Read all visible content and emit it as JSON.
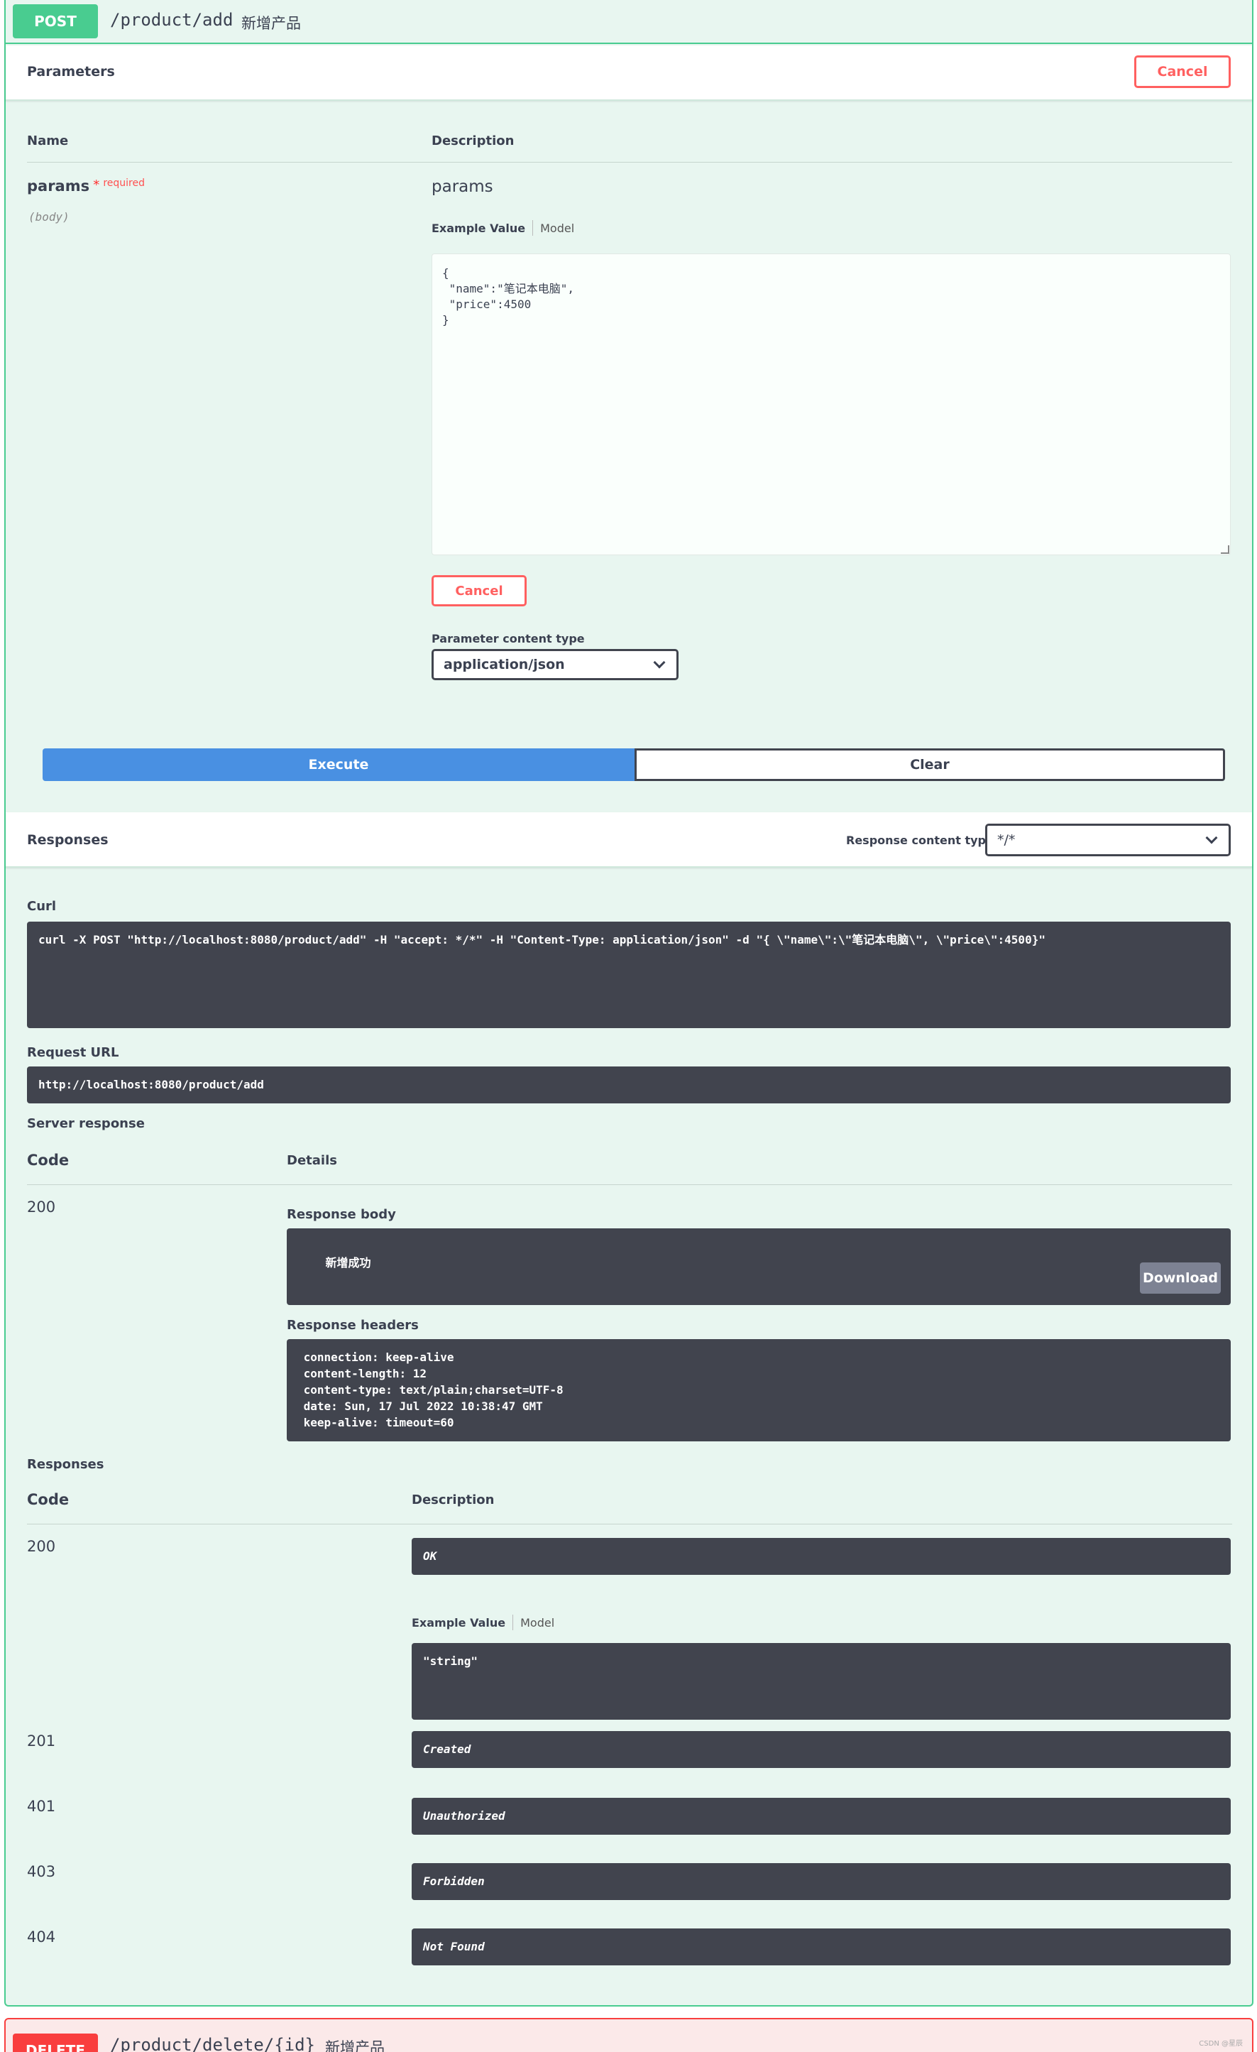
{
  "operation": {
    "method": "POST",
    "path": "/product/add",
    "summary": "新增产品"
  },
  "parameters": {
    "title": "Parameters",
    "cancel_label": "Cancel",
    "col_name": "Name",
    "col_description": "Description",
    "param_name": "params",
    "required_mark": "*",
    "required_label": "required",
    "param_in": "(body)",
    "param_description": "params",
    "example_value_label": "Example Value",
    "model_label": "Model",
    "body_value": "{\n \"name\":\"笔记本电脑\",\n \"price\":4500\n}",
    "cancel_small_label": "Cancel",
    "content_type_label": "Parameter content type",
    "content_type_value": "application/json"
  },
  "actions": {
    "execute_label": "Execute",
    "clear_label": "Clear"
  },
  "responses_header": {
    "title": "Responses",
    "content_type_label": "Response content type",
    "content_type_value": "*/*"
  },
  "live": {
    "curl_label": "Curl",
    "curl_value": "curl -X POST \"http://localhost:8080/product/add\" -H \"accept: */*\" -H \"Content-Type: application/json\" -d \"{ \\\"name\\\":\\\"笔记本电脑\\\", \\\"price\\\":4500}\"",
    "request_url_label": "Request URL",
    "request_url_value": "http://localhost:8080/product/add",
    "server_response_label": "Server response",
    "col_code": "Code",
    "col_details": "Details",
    "status_code": "200",
    "response_body_label": "Response body",
    "response_body_value": "新增成功",
    "download_label": "Download",
    "response_headers_label": "Response headers",
    "response_headers_value": " connection: keep-alive\n content-length: 12\n content-type: text/plain;charset=UTF-8\n date: Sun, 17 Jul 2022 10:38:47 GMT\n keep-alive: timeout=60"
  },
  "documented": {
    "title": "Responses",
    "col_code": "Code",
    "col_description": "Description",
    "example_value_label": "Example Value",
    "model_label": "Model",
    "example_value": "\"string\"",
    "rows": [
      {
        "code": "200",
        "description": "OK"
      },
      {
        "code": "201",
        "description": "Created"
      },
      {
        "code": "401",
        "description": "Unauthorized"
      },
      {
        "code": "403",
        "description": "Forbidden"
      },
      {
        "code": "404",
        "description": "Not Found"
      }
    ]
  },
  "next_operation": {
    "method": "DELETE",
    "path": "/product/delete/{id}",
    "summary": "新增产品"
  },
  "watermark": "CSDN @星辰"
}
